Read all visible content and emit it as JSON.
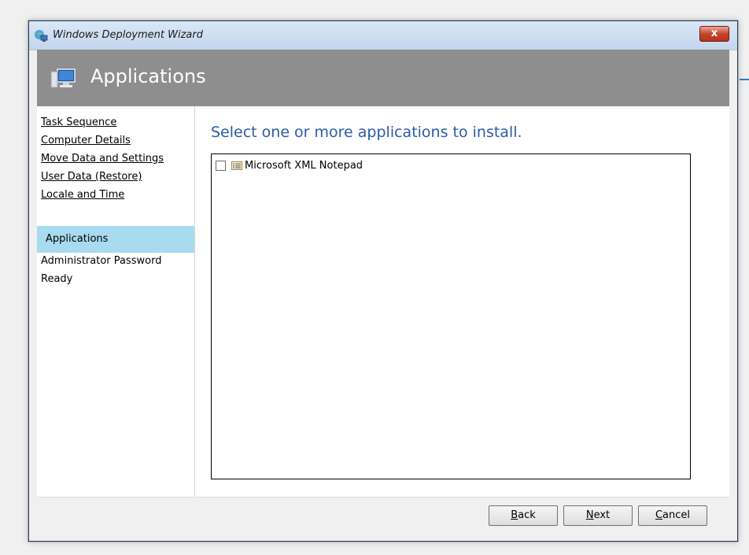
{
  "window": {
    "title": "Windows Deployment Wizard",
    "close_label": "x"
  },
  "header": {
    "title": "Applications",
    "icon": "computer-icon"
  },
  "nav": {
    "items": [
      {
        "label": "Task Sequence",
        "state": "completed-link"
      },
      {
        "label": "Computer Details",
        "state": "completed-link"
      },
      {
        "label": "Move Data and Settings",
        "state": "completed-link"
      },
      {
        "label": "User Data (Restore)",
        "state": "completed-link"
      },
      {
        "label": "Locale and Time",
        "state": "completed-link"
      },
      {
        "label": "Applications",
        "state": "active"
      },
      {
        "label": "Administrator Password",
        "state": "pending"
      },
      {
        "label": "Ready",
        "state": "pending"
      }
    ]
  },
  "main": {
    "heading": "Select one or more applications to install.",
    "applications": [
      {
        "label": "Microsoft XML Notepad",
        "checked": false,
        "icon": "application-icon"
      }
    ]
  },
  "footer": {
    "back": {
      "accel": "B",
      "rest": "ack"
    },
    "next": {
      "accel": "N",
      "rest": "ext"
    },
    "cancel": {
      "accel": "C",
      "rest": "ancel"
    }
  },
  "colors": {
    "heading": "#2c5ba8",
    "active_nav": "#a8daf0",
    "header_band": "#8e8e8e"
  }
}
